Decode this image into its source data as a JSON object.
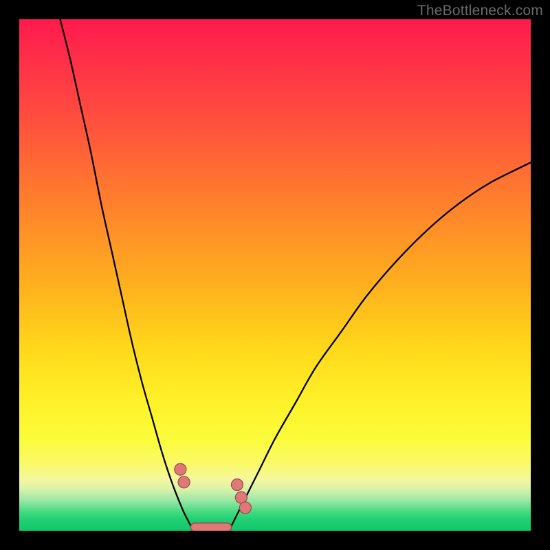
{
  "watermark": "TheBottleneck.com",
  "chart_data": {
    "type": "line",
    "title": "",
    "xlabel": "",
    "ylabel": "",
    "xlim": [
      0,
      100
    ],
    "ylim": [
      0,
      100
    ],
    "series": [
      {
        "name": "left-curve",
        "x": [
          8,
          10,
          12,
          14,
          16,
          18,
          20,
          22,
          24,
          26,
          28,
          30,
          32,
          33,
          34
        ],
        "y": [
          100,
          92,
          83,
          74,
          64,
          55,
          46,
          37,
          29,
          22,
          15,
          9,
          4,
          2,
          0
        ]
      },
      {
        "name": "valley-floor",
        "x": [
          34,
          36,
          38,
          40,
          41
        ],
        "y": [
          0,
          0,
          0,
          0,
          0
        ]
      },
      {
        "name": "right-curve",
        "x": [
          41,
          42,
          44,
          47,
          50,
          54,
          58,
          63,
          68,
          74,
          80,
          86,
          92,
          100
        ],
        "y": [
          0,
          2,
          6,
          12,
          18,
          25,
          32,
          39,
          46,
          53,
          59,
          64,
          68,
          72
        ]
      }
    ],
    "markers": [
      {
        "name": "left-marker-upper",
        "x": 31.5,
        "y": 12
      },
      {
        "name": "left-marker-lower",
        "x": 32.2,
        "y": 9.5
      },
      {
        "name": "right-marker-a",
        "x": 42.6,
        "y": 9
      },
      {
        "name": "right-marker-b",
        "x": 43.4,
        "y": 6.5
      },
      {
        "name": "right-marker-c",
        "x": 44.2,
        "y": 4.5
      }
    ],
    "floor_bar": {
      "x_start": 33.5,
      "x_end": 41.5,
      "y": 0.7
    }
  },
  "colors": {
    "marker_fill": "#e07878",
    "marker_stroke": "#9a4848",
    "curve_stroke": "#000000",
    "gradient_top": "#ff1a4d",
    "gradient_bottom": "#11c868"
  }
}
